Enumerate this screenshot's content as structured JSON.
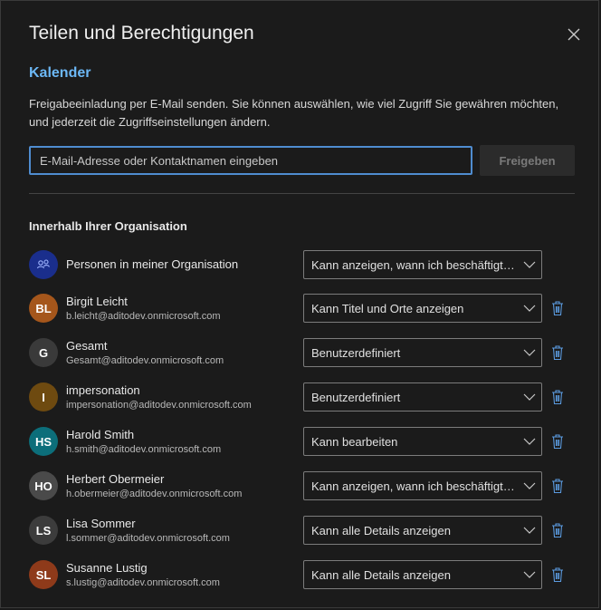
{
  "dialog": {
    "title": "Teilen und Berechtigungen",
    "calendar_name": "Kalender",
    "description": "Freigabeeinladung per E-Mail senden. Sie können auswählen, wie viel Zugriff Sie gewähren möchten, und jederzeit die Zugriffseinstellungen ändern.",
    "email_input": {
      "value": "",
      "placeholder": "E-Mail-Adresse oder Kontaktnamen eingeben"
    },
    "share_button": "Freigeben",
    "org_section_title": "Innerhalb Ihrer Organisation"
  },
  "colors": {
    "accent": "#6cb8f6",
    "input_focus_border": "#4f8cd0",
    "trash_icon": "#5b9be0",
    "group_avatar": "#1a2e8c"
  },
  "org_group": {
    "name": "Personen in meiner Organisation",
    "permission": "Kann anzeigen, wann ich beschäftigt bin",
    "icon": "people-group-icon"
  },
  "people": [
    {
      "initials": "BL",
      "name": "Birgit Leicht",
      "email": "b.leicht@aditodev.onmicrosoft.com",
      "permission": "Kann Titel und Orte anzeigen",
      "avatar_color": "#a5561b"
    },
    {
      "initials": "G",
      "name": "Gesamt",
      "email": "Gesamt@aditodev.onmicrosoft.com",
      "permission": "Benutzerdefiniert",
      "avatar_color": "#3a3a3a"
    },
    {
      "initials": "I",
      "name": "impersonation",
      "email": "impersonation@aditodev.onmicrosoft.com",
      "permission": "Benutzerdefiniert",
      "avatar_color": "#6e4a10"
    },
    {
      "initials": "HS",
      "name": "Harold Smith",
      "email": "h.smith@aditodev.onmicrosoft.com",
      "permission": "Kann bearbeiten",
      "avatar_color": "#0c6e7a"
    },
    {
      "initials": "HO",
      "name": "Herbert Obermeier",
      "email": "h.obermeier@aditodev.onmicrosoft.com",
      "permission": "Kann anzeigen, wann ich beschäftigt bin",
      "avatar_color": "#4a4a4a"
    },
    {
      "initials": "LS",
      "name": "Lisa Sommer",
      "email": "l.sommer@aditodev.onmicrosoft.com",
      "permission": "Kann alle Details anzeigen",
      "avatar_color": "#3c3c3c"
    },
    {
      "initials": "SL",
      "name": "Susanne Lustig",
      "email": "s.lustig@aditodev.onmicrosoft.com",
      "permission": "Kann alle Details anzeigen",
      "avatar_color": "#8e3a1a"
    }
  ]
}
